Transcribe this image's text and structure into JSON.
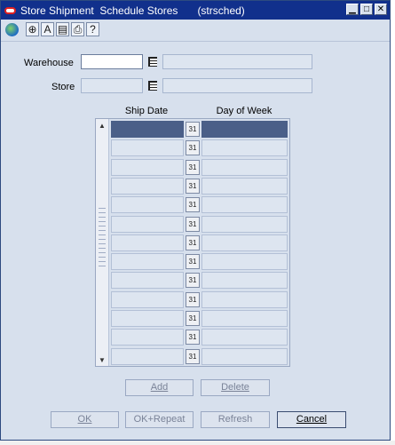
{
  "window": {
    "title": "Store Shipment  Schedule Stores",
    "module": "(strsched)",
    "controls": [
      "minimize",
      "maximize",
      "close"
    ]
  },
  "toolbar": {
    "icons": [
      "globe-icon",
      "help-icon",
      "language-icon",
      "copy-icon",
      "print-icon",
      "question-icon"
    ]
  },
  "form": {
    "warehouse_label": "Warehouse",
    "warehouse_value": "",
    "warehouse_desc": "",
    "store_label": "Store",
    "store_value": "",
    "store_desc": ""
  },
  "grid": {
    "headers": [
      "Ship Date",
      "Day of Week"
    ],
    "rows": [
      {
        "ship_date": "",
        "day": ""
      },
      {
        "ship_date": "",
        "day": ""
      },
      {
        "ship_date": "",
        "day": ""
      },
      {
        "ship_date": "",
        "day": ""
      },
      {
        "ship_date": "",
        "day": ""
      },
      {
        "ship_date": "",
        "day": ""
      },
      {
        "ship_date": "",
        "day": ""
      },
      {
        "ship_date": "",
        "day": ""
      },
      {
        "ship_date": "",
        "day": ""
      },
      {
        "ship_date": "",
        "day": ""
      },
      {
        "ship_date": "",
        "day": ""
      },
      {
        "ship_date": "",
        "day": ""
      },
      {
        "ship_date": "",
        "day": ""
      }
    ],
    "selected_row": 0,
    "calendar_icon_text": "31"
  },
  "buttons": {
    "add": "Add",
    "delete": "Delete",
    "ok": "OK",
    "ok_repeat": "OK+Repeat",
    "refresh": "Refresh",
    "cancel": "Cancel"
  }
}
